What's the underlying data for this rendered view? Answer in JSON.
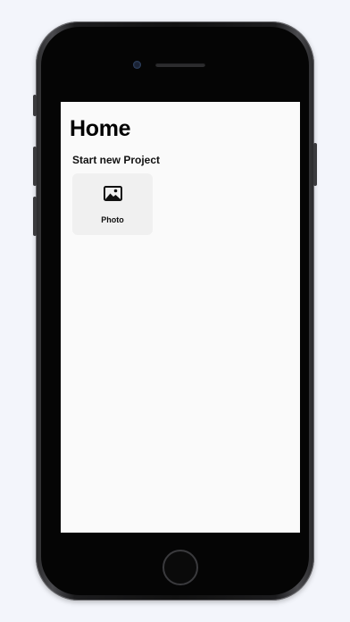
{
  "screen": {
    "title": "Home",
    "section_title": "Start new Project",
    "project_options": [
      {
        "label": "Photo",
        "icon": "photo-icon"
      }
    ]
  },
  "colors": {
    "background": "#f3f5fb",
    "screen": "#fafafa",
    "card": "#f0f0f0",
    "text": "#111111"
  }
}
